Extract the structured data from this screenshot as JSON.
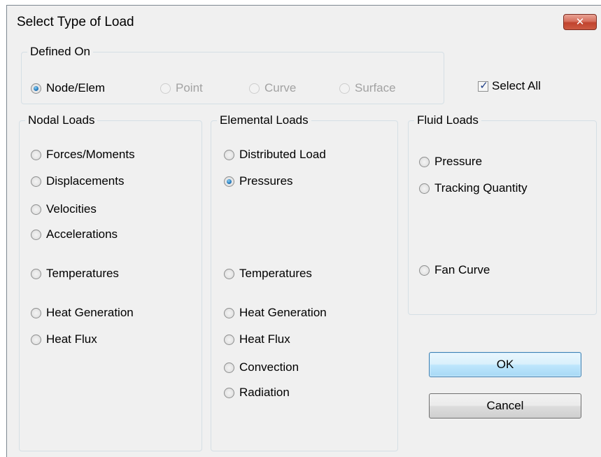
{
  "dialog": {
    "title": "Select Type of Load",
    "close_glyph": "✕",
    "close_icon": "close-icon"
  },
  "defined_on": {
    "legend": "Defined On",
    "options": [
      {
        "label": "Node/Elem",
        "checked": true,
        "enabled": true
      },
      {
        "label": "Point",
        "checked": false,
        "enabled": false
      },
      {
        "label": "Curve",
        "checked": false,
        "enabled": false
      },
      {
        "label": "Surface",
        "checked": false,
        "enabled": false
      }
    ],
    "select_all": {
      "label": "Select All",
      "checked": true,
      "check_glyph": "✓"
    }
  },
  "nodal_loads": {
    "legend": "Nodal Loads",
    "options": [
      {
        "label": "Forces/Moments"
      },
      {
        "label": "Displacements"
      },
      {
        "label": "Velocities"
      },
      {
        "label": "Accelerations"
      },
      {
        "label": "Temperatures"
      },
      {
        "label": "Heat Generation"
      },
      {
        "label": "Heat Flux"
      }
    ]
  },
  "elemental_loads": {
    "legend": "Elemental Loads",
    "selected": "Pressures",
    "options": [
      {
        "label": "Distributed Load"
      },
      {
        "label": "Pressures"
      },
      {
        "label": "Temperatures"
      },
      {
        "label": "Heat Generation"
      },
      {
        "label": "Heat Flux"
      },
      {
        "label": "Convection"
      },
      {
        "label": "Radiation"
      }
    ]
  },
  "fluid_loads": {
    "legend": "Fluid Loads",
    "options": [
      {
        "label": "Pressure"
      },
      {
        "label": "Tracking Quantity"
      },
      {
        "label": "Fan Curve"
      }
    ]
  },
  "buttons": {
    "ok_label": "OK",
    "cancel_label": "Cancel"
  },
  "colors": {
    "window_bg": "#f0f0f0",
    "close_red": "#c1432e",
    "radio_selected": "#2a7fc0",
    "default_button_border": "#3c7fb1"
  }
}
